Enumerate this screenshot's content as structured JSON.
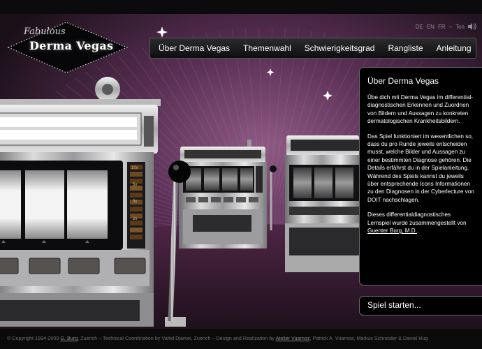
{
  "logo": {
    "script": "Fabulous",
    "main": "Derma Vegas"
  },
  "languages": [
    "DE",
    "EN",
    "FR"
  ],
  "sound": {
    "separator": "–",
    "label": "Ton"
  },
  "nav": [
    "Über Derma Vegas",
    "Themenwahl",
    "Schwierigkeitsgrad",
    "Rangliste",
    "Anleitung"
  ],
  "panel": {
    "title": "Über Derma Vegas",
    "p1": "Übe dich mit Derma Vegas im differential-diagnostischen Erkennen und Zuordnen von Bildern und Aussagen zu konkreten dermatologischen Krankheitsbildern.",
    "p2": "Das Spiel funktioniert im wesentlichen so, dass du pro Runde jeweils entscheiden musst, welche Bilder und Aussagen zu einer bestimmten Diagnose gehören. Die Details erfährst du in der Spielanleitung. Während des Spiels kannst du jeweils über entsprechende Icons Informationen zu den Diagnosen in der Cyberlecture von DOIT nachschlagen.",
    "p3_prefix": "Dieses differentialdiagnostisches Lernspiel wurde zusammengestellt von ",
    "p3_link": "Guenter Burg, M.D.",
    "p3_suffix": "."
  },
  "start_button": "Spiel starten...",
  "multipliers": [
    "10x",
    "5x",
    "3x",
    "2x"
  ],
  "footer": {
    "prefix": "© Copyright 1994-2009 ",
    "link1": "G. Burg",
    "middle": ", Zuerich – Technical Coordination by Vahid Djamei, Zuerich – Design and Realization by ",
    "link2": "Atelier Vuarnoz",
    "suffix": ", Patrick A. Vuarnoz, Markus Schneider & Daniel Hug"
  },
  "colors": {
    "background": "#1a1419",
    "purple_glow": "#7a4a72",
    "panel": "#000000",
    "text": "#ffffff",
    "footer_text": "#6e6e6e"
  }
}
